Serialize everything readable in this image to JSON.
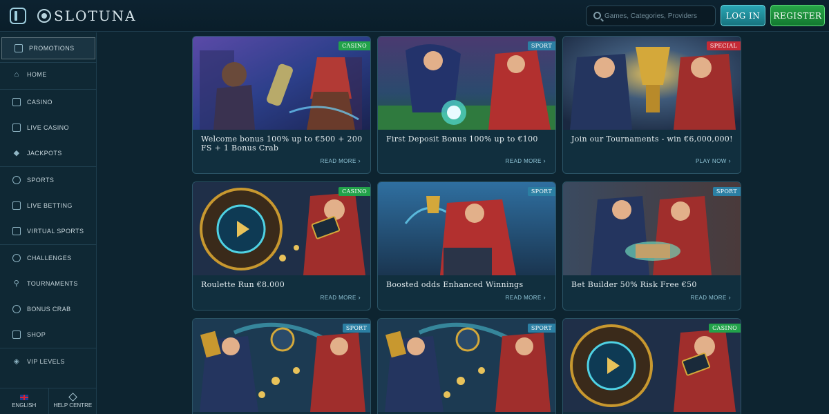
{
  "header": {
    "logo_text": "SLOTUNA",
    "search_placeholder": "Games, Categories, Providers",
    "login_label": "LOG IN",
    "register_label": "REGISTER"
  },
  "sidebar": {
    "items": [
      {
        "label": "PROMOTIONS",
        "icon": "gift-box-icon",
        "active": true
      },
      {
        "label": "HOME",
        "icon": "home-icon"
      },
      {
        "label": "CASINO",
        "icon": "slot-machine-icon"
      },
      {
        "label": "LIVE CASINO",
        "icon": "cards-icon"
      },
      {
        "label": "JACKPOTS",
        "icon": "diamond-icon"
      },
      {
        "label": "SPORTS",
        "icon": "soccer-ball-icon"
      },
      {
        "label": "LIVE BETTING",
        "icon": "live-screen-icon"
      },
      {
        "label": "VIRTUAL SPORTS",
        "icon": "virtual-screen-icon"
      },
      {
        "label": "CHALLENGES",
        "icon": "medal-icon"
      },
      {
        "label": "TOURNAMENTS",
        "icon": "trophy-icon"
      },
      {
        "label": "BONUS CRAB",
        "icon": "crab-icon"
      },
      {
        "label": "SHOP",
        "icon": "shop-icon"
      },
      {
        "label": "VIP LEVELS",
        "icon": "vip-gem-icon"
      }
    ],
    "bottom": {
      "language_label": "ENGLISH",
      "help_label": "HELP CENTRE"
    }
  },
  "promotions": [
    {
      "title": "Welcome bonus 100% up to €500 + 200 FS + 1 Bonus Crab",
      "badge": "CASINO",
      "link": "READ MORE"
    },
    {
      "title": "First Deposit Bonus 100% up to €100",
      "badge": "SPORT",
      "link": "READ MORE"
    },
    {
      "title": "Join our Tournaments - win €6,000,000!",
      "badge": "SPECIAL",
      "link": "PLAY NOW"
    },
    {
      "title": "Roulette Run €8.000",
      "badge": "CASINO",
      "link": "READ MORE"
    },
    {
      "title": "Boosted odds Enhanced Winnings",
      "badge": "SPORT",
      "link": "READ MORE"
    },
    {
      "title": "Bet Builder 50% Risk Free €50",
      "badge": "SPORT",
      "link": "READ MORE"
    },
    {
      "title": "",
      "badge": "SPORT",
      "link": ""
    },
    {
      "title": "",
      "badge": "SPORT",
      "link": ""
    },
    {
      "title": "",
      "badge": "CASINO",
      "link": ""
    }
  ],
  "colors": {
    "background": "#0d2430",
    "casino_badge": "#22a24a",
    "sport_badge": "#2b7fa3",
    "special_badge": "#c52a35",
    "login_button": "#2aa6b4",
    "register_button": "#27a548"
  }
}
